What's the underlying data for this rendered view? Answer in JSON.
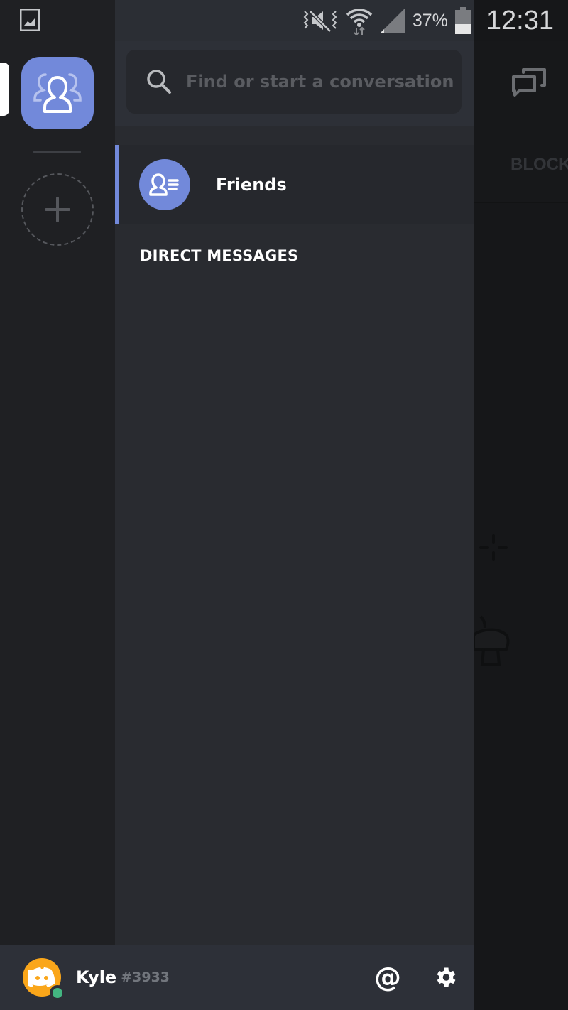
{
  "status_bar": {
    "icons": [
      "gallery-icon",
      "vibrate-mute-icon",
      "wifi-icon",
      "signal-icon",
      "battery-icon"
    ],
    "battery_percent": "37%",
    "time": "12:31"
  },
  "guild_rail": {
    "items": [
      {
        "name": "direct-messages",
        "icon": "friends-group-icon",
        "selected": true
      },
      {
        "name": "add-server",
        "icon": "plus-icon"
      }
    ]
  },
  "channel_panel": {
    "search": {
      "placeholder": "Find or start a conversation",
      "value": ""
    },
    "friends": {
      "label": "Friends",
      "icon": "friends-icon",
      "selected": true
    },
    "section_header": "DIRECT MESSAGES",
    "direct_messages": []
  },
  "right_pane": {
    "tab_label": "BLOCKED",
    "icons": [
      "new-group-dm-icon"
    ]
  },
  "user_bar": {
    "username": "Kyle",
    "discriminator": "#3933",
    "status": "online",
    "actions": {
      "mentions_label": "@",
      "settings_icon": "gear-icon"
    }
  },
  "colors": {
    "accent": "#7289da",
    "online": "#43b581",
    "avatar_bg": "#faa61a"
  }
}
